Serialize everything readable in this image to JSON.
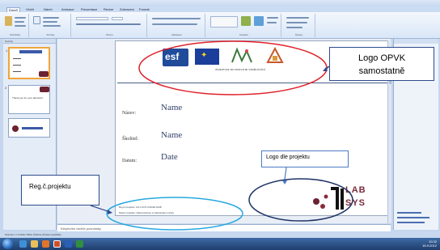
{
  "ribbon": {
    "tabs": [
      "Domů",
      "Vložit",
      "Návrh",
      "Animace",
      "Prezentace",
      "Revize",
      "Zobrazení",
      "Formát"
    ],
    "groups": [
      "Schránka",
      "Snímky",
      "Písmo",
      "Odstavec",
      "Kreslení",
      "Úpravy"
    ]
  },
  "left_panel": {
    "title": "Snímky",
    "slides": [
      {
        "num": "1",
        "selected": true
      },
      {
        "num": "2",
        "text": "Thank you for your attention!"
      },
      {
        "num": "",
        "text": ""
      }
    ]
  },
  "slide": {
    "banner_caption": "INVESTICE DO ROZVOJE VZDĚLÁVÁNÍ",
    "fields": [
      {
        "label": "Název:",
        "value": "Name"
      },
      {
        "label": "Školitel:",
        "value": "Name"
      },
      {
        "label": "Datum:",
        "value": "Date"
      }
    ],
    "reg_line": "Reg.č.projektu: CZ.1.07/2.3.00/20.0148",
    "project_line": "Název projektu: Rekonstrukce a zdokonalení výuky",
    "project_logo": {
      "top": "LAB",
      "bottom": "SYS"
    }
  },
  "notes": {
    "placeholder": "Klepnutím vložíte poznámky"
  },
  "status": {
    "text": "Snímek 1 z 2   Motiv Office   Čeština (Česká republika)"
  },
  "clock": {
    "time": "10:32",
    "date": "18.9.2012"
  },
  "callouts": {
    "opvk_line1": "Logo OPVK",
    "opvk_line2": "samostatně",
    "project_logo": "Logo dle projektu",
    "reg": "Reg.č.projektu"
  },
  "colors": {
    "callout_border": "#2d4b8c",
    "red_ellipse": "#e0202a",
    "blue_ellipse": "#27a8e0",
    "navy_ellipse": "#1f3466"
  },
  "icons": [
    "start-orb-icon",
    "ie-icon",
    "explorer-icon",
    "media-icon",
    "powerpoint-icon",
    "word-icon",
    "excel-icon"
  ]
}
